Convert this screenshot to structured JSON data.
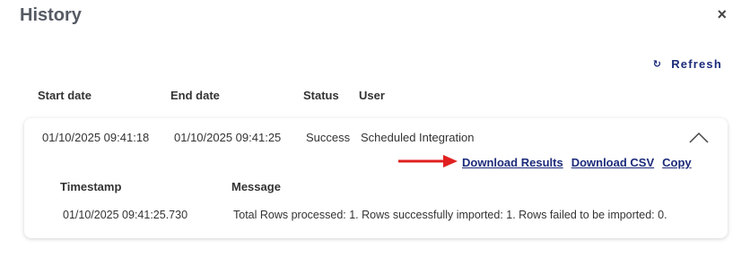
{
  "dialog": {
    "title": "History",
    "close_label": "×"
  },
  "toolbar": {
    "refresh_label": "Refresh",
    "refresh_icon": "↻"
  },
  "table": {
    "headers": [
      "Start date",
      "End date",
      "Status",
      "User"
    ],
    "rows": [
      {
        "start": "01/10/2025 09:41:18",
        "end": "01/10/2025 09:41:25",
        "status": "Success",
        "user": "Scheduled Integration",
        "expanded": true,
        "links": [
          "Download Results",
          "Download CSV",
          "Copy"
        ],
        "details": {
          "headers": [
            "Timestamp",
            "Message"
          ],
          "rows": [
            {
              "timestamp": "01/10/2025 09:41:25.730",
              "message": "Total Rows processed: 1. Rows successfully imported: 1. Rows failed to be imported: 0."
            }
          ]
        }
      }
    ]
  },
  "colors": {
    "link": "#1c2b7a",
    "arrow": "#e02020",
    "title": "#555a63"
  }
}
